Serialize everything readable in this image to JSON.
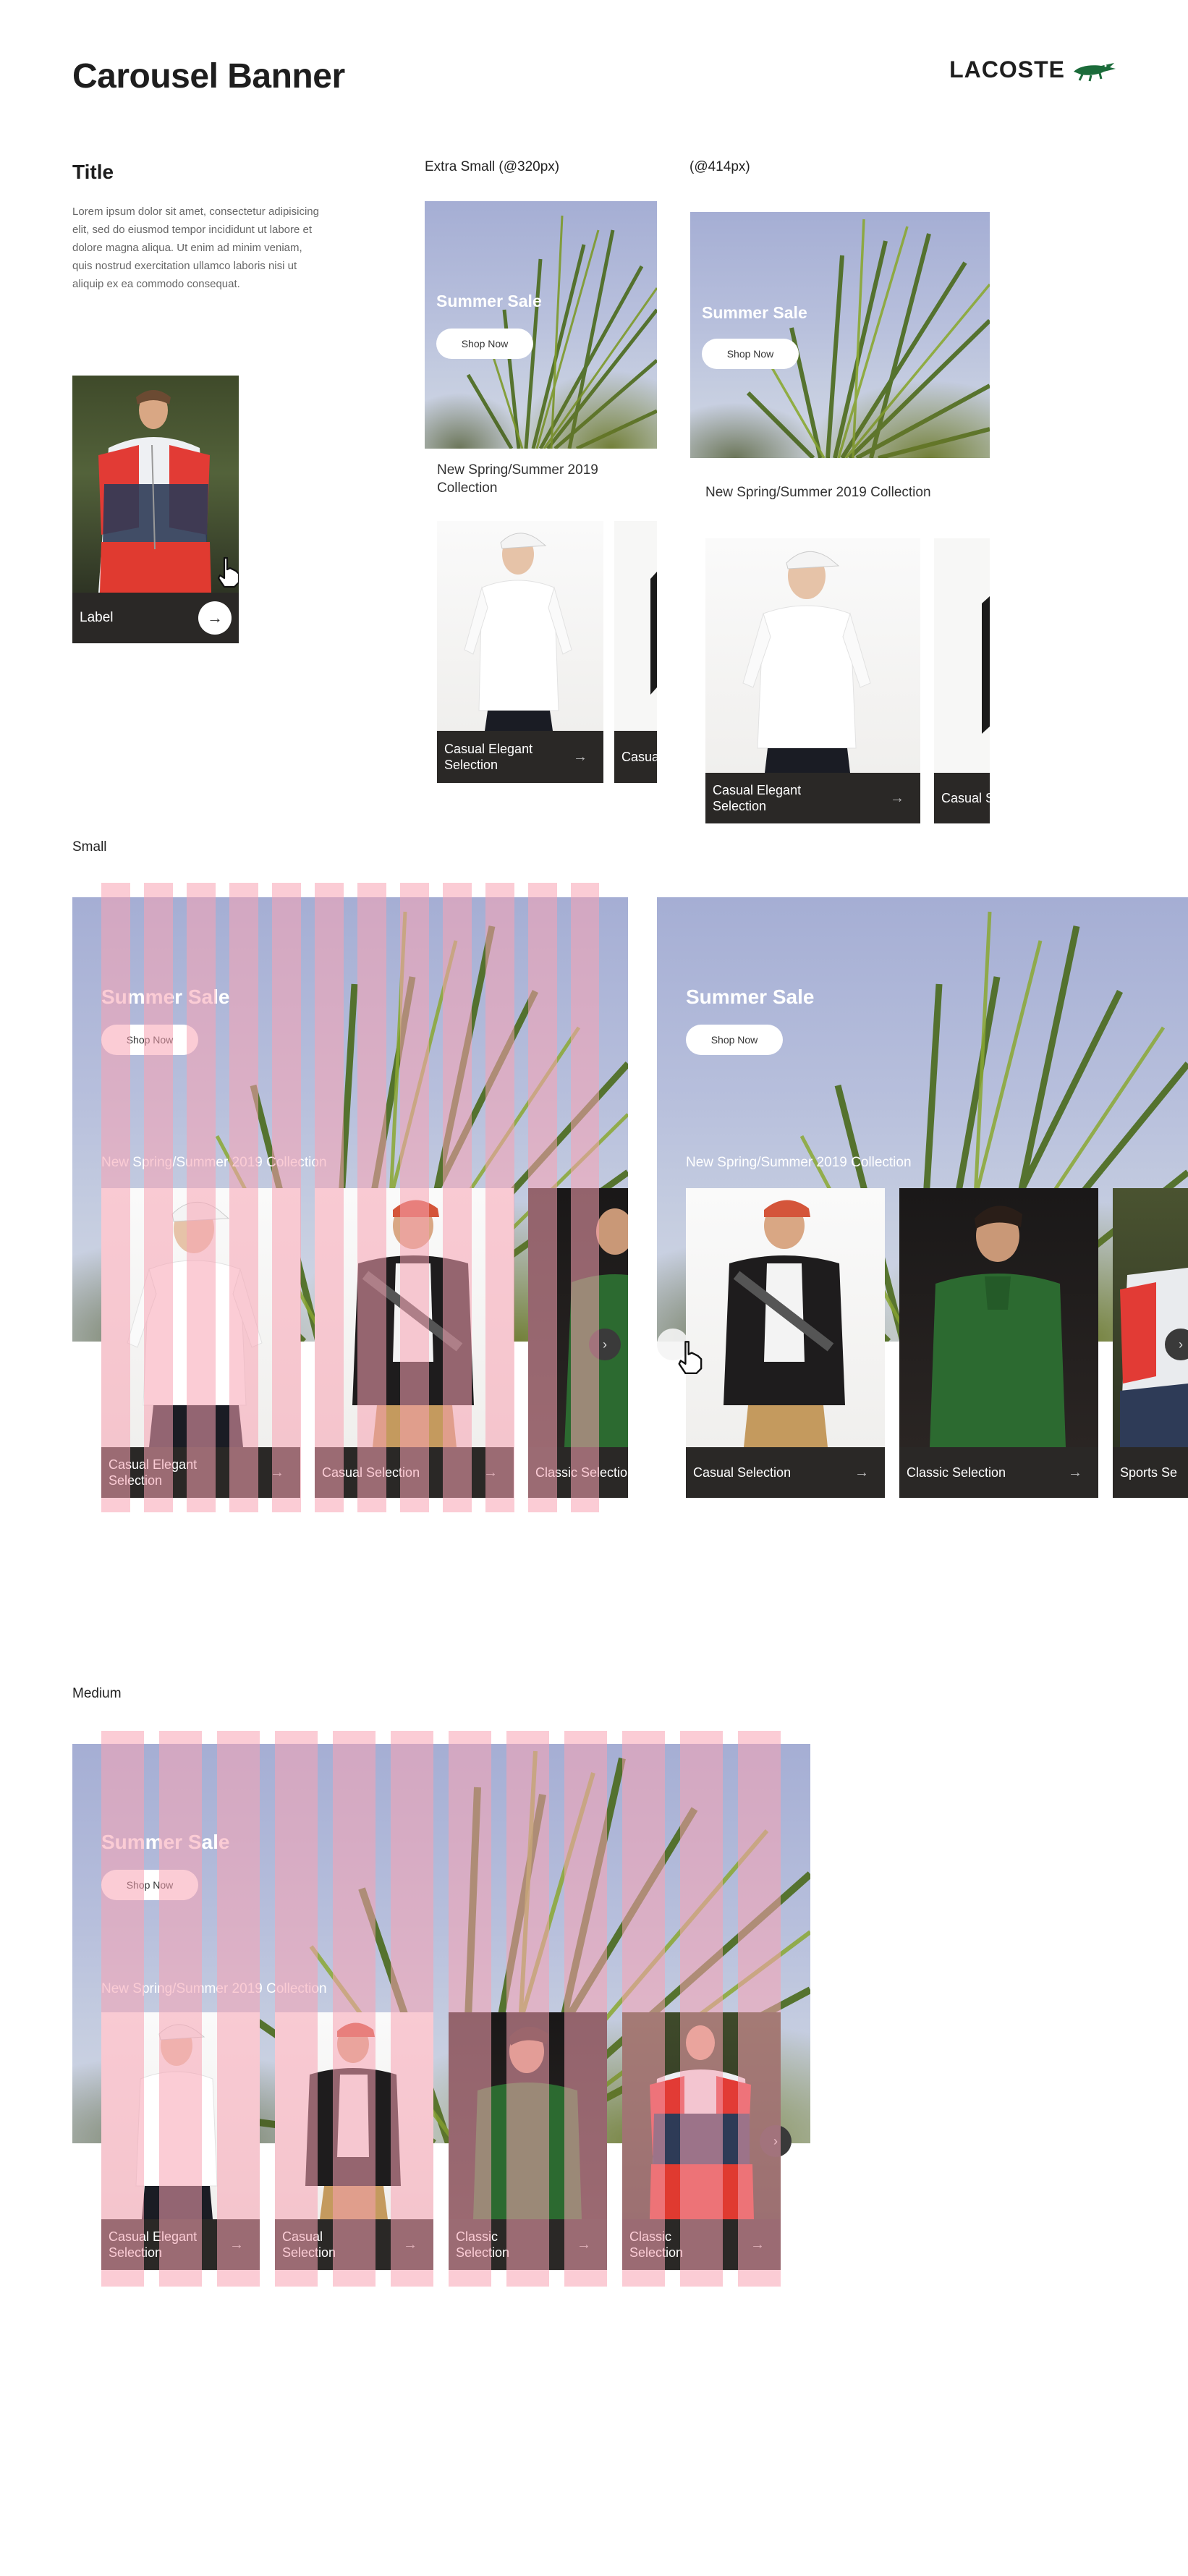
{
  "header": {
    "title": "Carousel Banner",
    "brand": "LACOSTE"
  },
  "component": {
    "title": "Title",
    "description": "Lorem ipsum dolor sit amet, consectetur adipisicing elit, sed do eiusmod tempor incididunt ut labore et dolore magna aliqua. Ut enim ad minim veniam, quis nostrud exercitation ullamco laboris nisi ut aliquip ex ea commodo consequat.",
    "card_label": "Label"
  },
  "sections": {
    "xs_320": "Extra Small (@320px)",
    "xs_414": "(@414px)",
    "small": "Small",
    "medium": "Medium"
  },
  "banner": {
    "sale": "Summer Sale",
    "shop": "Shop Now",
    "collection": "New Spring/Summer 2019 Collection"
  },
  "cards": {
    "casual_elegant": "Casual Elegant Selection",
    "casual": "Casual Selection",
    "classic": "Classic Selection",
    "sports": "Sports Se"
  },
  "icons": [
    "arrow-right-icon",
    "chevron-right-icon",
    "hand-cursor-icon",
    "crocodile-logo-icon"
  ],
  "colors": {
    "caption_bg": "#2a2826",
    "grid_overlay": "#f7a3b2",
    "accent": "#1b6b3a"
  }
}
